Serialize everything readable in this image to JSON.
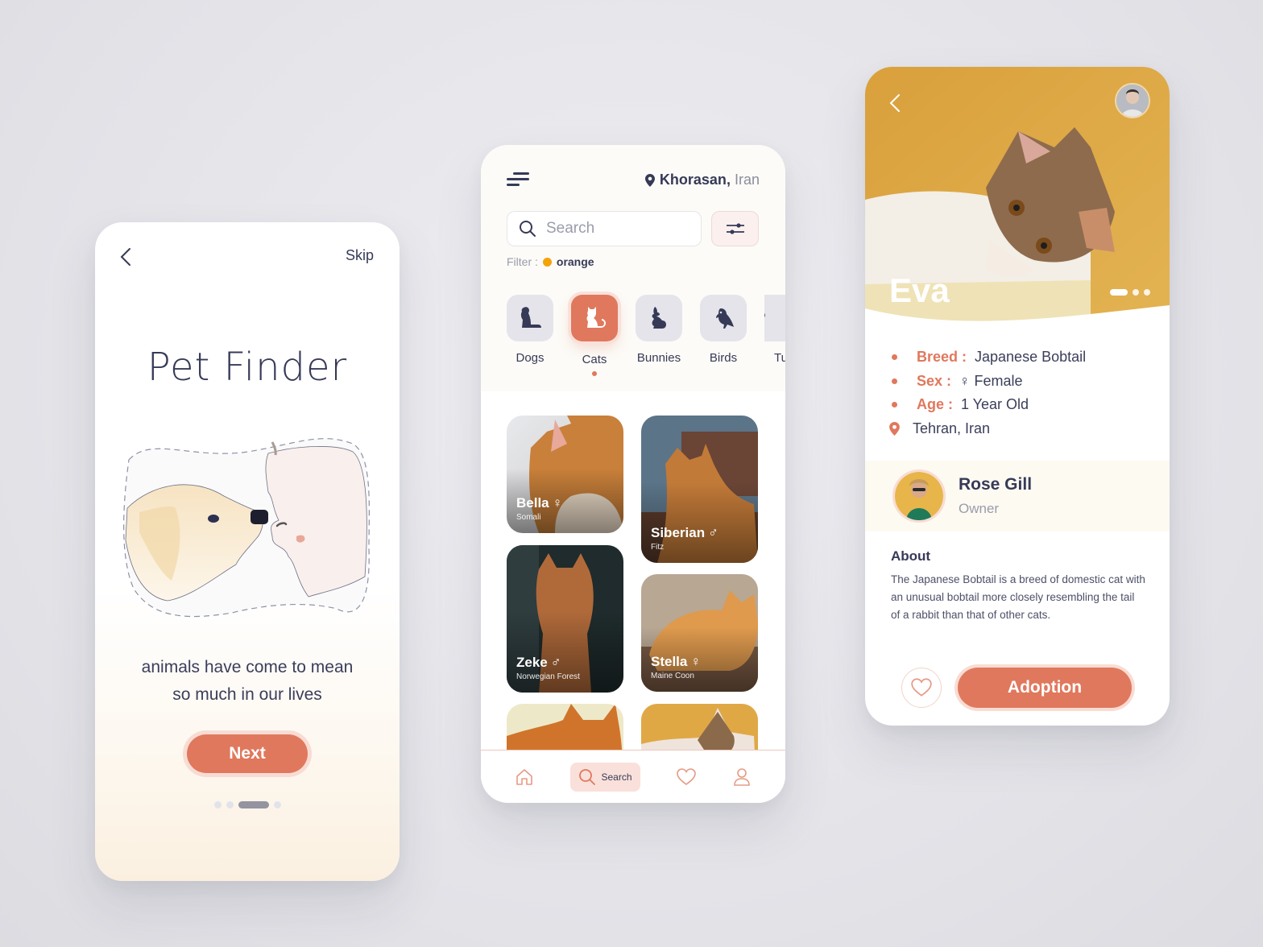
{
  "theme": {
    "accent": "#e0785d",
    "dark": "#363a57",
    "muted": "#9a9cab",
    "filter_swatch": "#f5a30b"
  },
  "onboarding": {
    "skip_label": "Skip",
    "title": "Pet Finder",
    "tagline_line1": "animals have come to mean",
    "tagline_line2": "so much in our lives",
    "next_label": "Next",
    "page_count": 4,
    "active_page": 3
  },
  "search_screen": {
    "location_bold": "Khorasan",
    "location_sep": ",",
    "location_light": "Iran",
    "search_placeholder": "Search",
    "filter_label": "Filter :",
    "filter_value": "orange",
    "categories": [
      {
        "label": "Dogs",
        "icon": "dog-icon",
        "active": false
      },
      {
        "label": "Cats",
        "icon": "cat-icon",
        "active": true
      },
      {
        "label": "Bunnies",
        "icon": "rabbit-icon",
        "active": false
      },
      {
        "label": "Birds",
        "icon": "bird-icon",
        "active": false
      },
      {
        "label": "Tu",
        "icon": "turtle-icon",
        "active": false
      }
    ],
    "pets": [
      {
        "name": "Bella",
        "sex": "♀",
        "breed": "Somali"
      },
      {
        "name": "Siberian",
        "sex": "♂",
        "breed": "Fitz"
      },
      {
        "name": "Zeke",
        "sex": "♂",
        "breed": "Norwegian Forest"
      },
      {
        "name": "Stella",
        "sex": "♀",
        "breed": "Maine Coon"
      }
    ],
    "nav": {
      "home": "home-icon",
      "search_label": "Search",
      "favorites": "heart-icon",
      "profile": "user-icon"
    }
  },
  "detail": {
    "pet_name": "Eva",
    "image_count": 3,
    "active_image": 1,
    "breed_key": "Breed :",
    "breed_value": "Japanese Bobtail",
    "sex_key": "Sex :",
    "sex_value": "♀ Female",
    "age_key": "Age :",
    "age_value": "1 Year Old",
    "location": "Tehran, Iran",
    "owner_name": "Rose Gill",
    "owner_role": "Owner",
    "about_heading": "About",
    "about_text": "The Japanese Bobtail is a breed of domestic cat with an unusual bobtail more closely resembling the tail of a rabbit than that of other cats.",
    "adopt_label": "Adoption"
  }
}
